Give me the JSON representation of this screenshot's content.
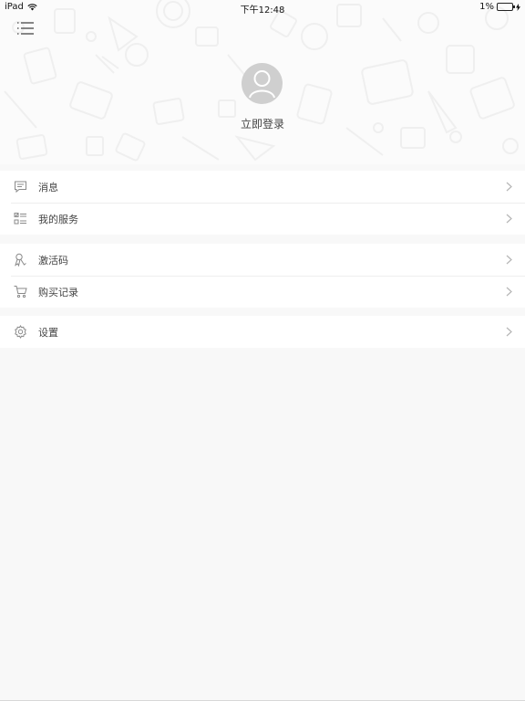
{
  "status_bar": {
    "device": "iPad",
    "time": "下午12:48",
    "battery": "1%"
  },
  "header": {
    "login_label": "立即登录"
  },
  "menu_groups": [
    {
      "items": [
        {
          "label": "消息",
          "icon": "message-icon"
        },
        {
          "label": "我的服务",
          "icon": "service-list-icon"
        }
      ]
    },
    {
      "items": [
        {
          "label": "激活码",
          "icon": "activation-code-icon"
        },
        {
          "label": "购买记录",
          "icon": "shopping-cart-icon"
        }
      ]
    },
    {
      "items": [
        {
          "label": "设置",
          "icon": "gear-icon"
        }
      ]
    }
  ],
  "colors": {
    "page_background": "#f8f8f8",
    "row_background": "#ffffff",
    "avatar_gray": "#cfcfcf",
    "icon_gray": "#8a8a8a"
  }
}
